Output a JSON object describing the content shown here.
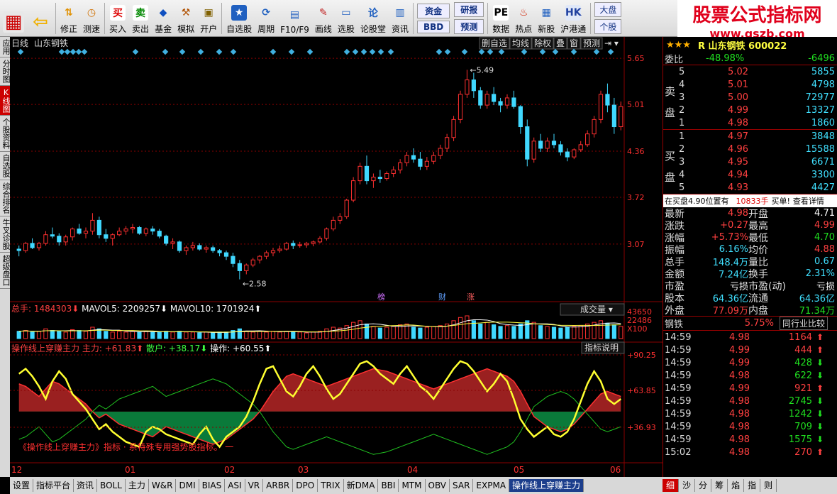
{
  "toolbar": {
    "buttons": [
      {
        "label": "",
        "icon": "app-icon"
      },
      {
        "label": "",
        "icon": "back-arrow-icon"
      },
      {
        "label": "修正",
        "icon": "updown-icon"
      },
      {
        "label": "测速",
        "icon": "clock-icon"
      },
      {
        "label": "买入",
        "icon": "buy-icon",
        "glyph": "买"
      },
      {
        "label": "卖出",
        "icon": "sell-icon",
        "glyph": "卖"
      },
      {
        "label": "基金",
        "icon": "fund-icon"
      },
      {
        "label": "模拟",
        "icon": "hammer-icon"
      },
      {
        "label": "开户",
        "icon": "lock-icon"
      },
      {
        "label": "自选股",
        "icon": "star-icon"
      },
      {
        "label": "周期",
        "icon": "cycle-icon"
      },
      {
        "label": "F10/F9",
        "icon": "f10-icon"
      },
      {
        "label": "画线",
        "icon": "pen-icon"
      },
      {
        "label": "选股",
        "icon": "monitor-icon"
      },
      {
        "label": "论股堂",
        "icon": "forum-icon",
        "glyph": "论"
      },
      {
        "label": "资讯",
        "icon": "doc-icon"
      },
      {
        "label": "资金",
        "icon": "fund-flow-icon"
      },
      {
        "label": "BBD",
        "icon": ""
      },
      {
        "label": "研报",
        "icon": ""
      },
      {
        "label": "预测",
        "icon": ""
      },
      {
        "label": "数据",
        "icon": "pe-icon",
        "glyph": "PE"
      },
      {
        "label": "热点",
        "icon": "fire-icon"
      },
      {
        "label": "新股",
        "icon": "newstock-icon"
      },
      {
        "label": "沪港通",
        "icon": "hk-icon"
      },
      {
        "label": "大盘",
        "icon": ""
      },
      {
        "label": "个股",
        "icon": ""
      }
    ],
    "brand_title": "股票公式指标网",
    "brand_url": "www.gszb.com"
  },
  "left_tabs": [
    "应用",
    "分时图",
    "K线图",
    "个股资料",
    "自选股",
    "综合排名",
    "牛叉诊股",
    "超级盘口"
  ],
  "chart": {
    "period": "日线",
    "stock_name": "山东钢铁",
    "top_menu": [
      "删自选",
      "均线",
      "除权",
      "叠",
      "窗",
      "预测"
    ],
    "price_levels": [
      "5.65",
      "5.01",
      "4.36",
      "3.72",
      "3.07"
    ],
    "high_label": "5.49",
    "low_label": "2.58",
    "event_labels": [
      {
        "text": "榜",
        "color": "#d070ff"
      },
      {
        "text": "财",
        "color": "#60a0ff"
      },
      {
        "text": "涨",
        "color": "#ff6060"
      }
    ],
    "volume": {
      "total_label": "总手:",
      "total_value": "1484303",
      "mavol5_label": "MAVOL5:",
      "mavol5_value": "2209257",
      "mavol10_label": "MAVOL10:",
      "mavol10_value": "1701924",
      "dropdown": "成交量",
      "levels": [
        "43650",
        "22486",
        "X100"
      ]
    },
    "indicator": {
      "name": "操作线上穿赚主力",
      "main_label": "主力:",
      "main_value": "+61.83",
      "retail_label": "散户:",
      "retail_value": "+38.17",
      "op_label": "操作:",
      "op_value": "+60.55",
      "explain_button": "指标说明",
      "levels": [
        "+90.25",
        "+63.85",
        "+36.93"
      ],
      "footer_text": "《操作线上穿赚主力》指标 · 系特殊专用强势股指标。 一"
    },
    "x_axis": [
      "12",
      "01",
      "02",
      "03",
      "04",
      "05",
      "06"
    ]
  },
  "chart_data": {
    "type": "candlestick",
    "title": "山东钢铁 日线",
    "ylim": [
      2.3,
      5.75
    ],
    "candles": [
      [
        3.0,
        3.05,
        2.9,
        2.98
      ],
      [
        2.98,
        3.1,
        2.95,
        3.08
      ],
      [
        3.08,
        3.15,
        3.0,
        3.02
      ],
      [
        3.02,
        3.1,
        2.98,
        3.08
      ],
      [
        3.08,
        3.25,
        3.05,
        3.2
      ],
      [
        3.2,
        3.3,
        3.15,
        3.18
      ],
      [
        3.18,
        3.22,
        3.05,
        3.1
      ],
      [
        3.1,
        3.2,
        3.05,
        3.17
      ],
      [
        3.17,
        3.3,
        3.12,
        3.28
      ],
      [
        3.28,
        3.35,
        3.2,
        3.22
      ],
      [
        3.22,
        3.3,
        3.15,
        3.25
      ],
      [
        3.25,
        3.5,
        3.2,
        3.4
      ],
      [
        3.4,
        3.45,
        3.15,
        3.2
      ],
      [
        3.2,
        3.28,
        3.1,
        3.15
      ],
      [
        3.15,
        3.22,
        3.05,
        3.2
      ],
      [
        3.2,
        3.3,
        3.18,
        3.25
      ],
      [
        3.25,
        3.32,
        3.2,
        3.28
      ],
      [
        3.28,
        3.35,
        3.22,
        3.3
      ],
      [
        3.3,
        3.32,
        3.2,
        3.22
      ],
      [
        3.22,
        3.3,
        3.18,
        3.28
      ],
      [
        3.28,
        3.32,
        3.2,
        3.25
      ],
      [
        3.25,
        3.28,
        3.15,
        3.18
      ],
      [
        3.18,
        3.2,
        3.05,
        3.08
      ],
      [
        3.08,
        3.15,
        3.0,
        3.1
      ],
      [
        3.1,
        3.12,
        2.95,
        2.98
      ],
      [
        2.98,
        3.05,
        2.92,
        3.02
      ],
      [
        3.02,
        3.1,
        2.98,
        3.05
      ],
      [
        3.05,
        3.08,
        2.98,
        3.0
      ],
      [
        3.0,
        3.05,
        2.95,
        3.02
      ],
      [
        3.02,
        3.05,
        2.95,
        2.98
      ],
      [
        2.98,
        3.0,
        2.9,
        2.95
      ],
      [
        2.95,
        2.98,
        2.85,
        2.9
      ],
      [
        2.9,
        2.95,
        2.75,
        2.8
      ],
      [
        2.8,
        2.85,
        2.58,
        2.7
      ],
      [
        2.7,
        2.8,
        2.65,
        2.78
      ],
      [
        2.78,
        2.88,
        2.75,
        2.85
      ],
      [
        2.85,
        2.92,
        2.8,
        2.9
      ],
      [
        2.9,
        2.98,
        2.86,
        2.95
      ],
      [
        2.95,
        3.02,
        2.9,
        2.98
      ],
      [
        2.98,
        3.05,
        2.95,
        3.0
      ],
      [
        3.0,
        3.1,
        2.98,
        3.08
      ],
      [
        3.08,
        3.12,
        3.0,
        3.05
      ],
      [
        3.05,
        3.1,
        3.02,
        3.06
      ],
      [
        3.06,
        3.1,
        3.02,
        3.08
      ],
      [
        3.08,
        3.12,
        3.04,
        3.1
      ],
      [
        3.1,
        3.18,
        3.08,
        3.15
      ],
      [
        3.15,
        3.3,
        3.12,
        3.28
      ],
      [
        3.28,
        3.45,
        3.25,
        3.4
      ],
      [
        3.4,
        3.5,
        3.35,
        3.45
      ],
      [
        3.45,
        3.7,
        3.42,
        3.68
      ],
      [
        3.68,
        4.0,
        3.65,
        3.95
      ],
      [
        3.95,
        4.2,
        3.9,
        4.15
      ],
      [
        4.15,
        4.3,
        3.9,
        3.95
      ],
      [
        3.95,
        4.05,
        3.85,
        4.0
      ],
      [
        4.0,
        4.1,
        3.92,
        3.98
      ],
      [
        3.98,
        4.08,
        3.95,
        4.05
      ],
      [
        4.05,
        4.15,
        4.0,
        4.1
      ],
      [
        4.1,
        4.25,
        4.05,
        4.2
      ],
      [
        4.2,
        4.35,
        4.15,
        4.3
      ],
      [
        4.3,
        4.4,
        4.2,
        4.25
      ],
      [
        4.25,
        4.35,
        4.1,
        4.15
      ],
      [
        4.15,
        4.28,
        4.1,
        4.22
      ],
      [
        4.22,
        4.35,
        4.18,
        4.3
      ],
      [
        4.3,
        4.45,
        4.25,
        4.4
      ],
      [
        4.4,
        4.6,
        4.35,
        4.55
      ],
      [
        4.55,
        4.85,
        4.5,
        4.8
      ],
      [
        4.8,
        5.2,
        4.75,
        5.15
      ],
      [
        5.15,
        5.49,
        5.1,
        5.35
      ],
      [
        5.35,
        5.45,
        5.1,
        5.2
      ],
      [
        5.2,
        5.25,
        4.95,
        5.0
      ],
      [
        5.0,
        5.2,
        4.95,
        5.15
      ],
      [
        5.15,
        5.25,
        5.0,
        5.05
      ],
      [
        5.05,
        5.1,
        4.9,
        5.0
      ],
      [
        5.0,
        5.15,
        4.95,
        5.1
      ],
      [
        5.1,
        5.2,
        4.95,
        4.98
      ],
      [
        4.98,
        5.0,
        4.6,
        4.7
      ],
      [
        4.7,
        4.8,
        4.15,
        4.25
      ],
      [
        4.25,
        4.55,
        4.2,
        4.5
      ],
      [
        4.5,
        4.6,
        4.35,
        4.4
      ],
      [
        4.4,
        4.55,
        4.35,
        4.5
      ],
      [
        4.5,
        4.6,
        4.4,
        4.45
      ],
      [
        4.45,
        4.5,
        4.3,
        4.35
      ],
      [
        4.35,
        4.4,
        4.22,
        4.28
      ],
      [
        4.28,
        4.4,
        4.25,
        4.38
      ],
      [
        4.38,
        4.5,
        4.35,
        4.45
      ],
      [
        4.45,
        4.65,
        4.42,
        4.6
      ],
      [
        4.6,
        4.85,
        4.55,
        4.8
      ],
      [
        4.8,
        5.2,
        4.75,
        5.15
      ],
      [
        5.15,
        5.3,
        4.9,
        5.0
      ],
      [
        5.0,
        5.1,
        4.6,
        4.7
      ],
      [
        4.7,
        5.05,
        4.65,
        4.98
      ]
    ],
    "volume": [
      9,
      10,
      8,
      9,
      12,
      10,
      9,
      8,
      11,
      10,
      9,
      14,
      12,
      9,
      8,
      9,
      8,
      9,
      8,
      9,
      8,
      8,
      9,
      8,
      9,
      8,
      8,
      7,
      8,
      7,
      8,
      8,
      10,
      12,
      9,
      8,
      9,
      8,
      9,
      8,
      9,
      8,
      8,
      7,
      8,
      9,
      12,
      14,
      13,
      16,
      20,
      22,
      18,
      15,
      13,
      14,
      15,
      17,
      18,
      14,
      13,
      14,
      15,
      16,
      18,
      22,
      26,
      28,
      22,
      18,
      20,
      17,
      15,
      16,
      15,
      18,
      22,
      20,
      16,
      15,
      14,
      13,
      14,
      15,
      16,
      18,
      20,
      22,
      19,
      17,
      15
    ],
    "indicator_main": [
      72,
      70,
      66,
      62,
      68,
      74,
      72,
      68,
      64,
      60,
      56,
      50,
      45,
      48,
      44,
      40,
      38,
      36,
      34,
      32,
      30,
      34,
      38,
      36,
      34,
      32,
      30,
      28,
      26,
      24,
      26,
      28,
      32,
      36,
      40,
      44,
      50,
      58,
      66,
      72,
      78,
      80,
      78,
      76,
      74,
      72,
      70,
      72,
      74,
      76,
      78,
      80,
      82,
      84,
      83,
      82,
      80,
      78,
      76,
      74,
      72,
      70,
      68,
      70,
      72,
      74,
      76,
      78,
      80,
      82,
      84,
      82,
      80,
      78,
      74,
      66,
      56,
      46,
      42,
      38,
      36,
      34,
      36,
      40,
      46,
      52,
      58,
      64,
      66,
      64,
      62
    ],
    "indicator_op": [
      80,
      84,
      78,
      70,
      60,
      74,
      82,
      76,
      64,
      58,
      52,
      44,
      36,
      40,
      34,
      30,
      26,
      24,
      22,
      34,
      38,
      36,
      32,
      30,
      28,
      26,
      24,
      32,
      38,
      28,
      22,
      30,
      34,
      38,
      46,
      58,
      72,
      84,
      86,
      76,
      66,
      62,
      70,
      80,
      86,
      78,
      68,
      60,
      64,
      72,
      80,
      88,
      90,
      86,
      80,
      76,
      72,
      80,
      86,
      78,
      70,
      66,
      60,
      68,
      76,
      84,
      90,
      88,
      82,
      74,
      66,
      72,
      80,
      74,
      60,
      44,
      36,
      30,
      34,
      38,
      32,
      30,
      34,
      44,
      58,
      72,
      82,
      74,
      60,
      56,
      60
    ]
  },
  "right_panel": {
    "stars": "★★★",
    "stock_code_label": "R 山东钢铁 600022",
    "weibi_label": "委比",
    "weibi_value": "-48.98%",
    "weibi_diff": "-6496",
    "sell_label_1": "卖",
    "sell_label_2": "盘",
    "buy_label_1": "买",
    "buy_label_2": "盘",
    "sells": [
      {
        "level": "5",
        "price": "5.02",
        "vol": "5855"
      },
      {
        "level": "4",
        "price": "5.01",
        "vol": "4798"
      },
      {
        "level": "3",
        "price": "5.00",
        "vol": "72977"
      },
      {
        "level": "2",
        "price": "4.99",
        "vol": "13327"
      },
      {
        "level": "1",
        "price": "4.98",
        "vol": "1860"
      }
    ],
    "buys": [
      {
        "level": "1",
        "price": "4.97",
        "vol": "3848"
      },
      {
        "level": "2",
        "price": "4.96",
        "vol": "15588"
      },
      {
        "level": "3",
        "price": "4.95",
        "vol": "6671"
      },
      {
        "level": "4",
        "price": "4.94",
        "vol": "3300"
      },
      {
        "level": "5",
        "price": "4.93",
        "vol": "4427"
      }
    ],
    "notice_text": "在买盘4.90位置有",
    "notice_vol": "10833手",
    "notice_action": "买单!",
    "notice_link": "查看详情",
    "quote_rows": [
      {
        "k1": "最新",
        "v1": "4.98",
        "c1": "red",
        "k2": "开盘",
        "v2": "4.71",
        "c2": "white"
      },
      {
        "k1": "涨跌",
        "v1": "+0.27",
        "c1": "red",
        "k2": "最高",
        "v2": "4.99",
        "c2": "red"
      },
      {
        "k1": "涨幅",
        "v1": "+5.73%",
        "c1": "red",
        "k2": "最低",
        "v2": "4.70",
        "c2": "green"
      },
      {
        "k1": "振幅",
        "v1": "6.16%",
        "c1": "cyan",
        "k2": "均价",
        "v2": "4.88",
        "c2": "red"
      },
      {
        "k1": "总手",
        "v1": "148.4万",
        "c1": "cyan",
        "k2": "量比",
        "v2": "0.67",
        "c2": "cyan"
      },
      {
        "k1": "金额",
        "v1": "7.24亿",
        "c1": "cyan",
        "k2": "换手",
        "v2": "2.31%",
        "c2": "cyan"
      },
      {
        "k1": "市盈",
        "v1": "亏损",
        "c1": "white",
        "k2": "市盈(动)",
        "v2": "亏损",
        "c2": "white"
      },
      {
        "k1": "股本",
        "v1": "64.36亿",
        "c1": "cyan",
        "k2": "流通",
        "v2": "64.36亿",
        "c2": "cyan"
      },
      {
        "k1": "外盘",
        "v1": "77.09万",
        "c1": "red",
        "k2": "内盘",
        "v2": "71.34万",
        "c2": "green"
      }
    ],
    "sector_label": "钢铁",
    "sector_pct": "5.75%",
    "sector_button": "同行业比较",
    "ticks": [
      {
        "time": "14:59",
        "price": "4.98",
        "vol": "1164",
        "dir": "up"
      },
      {
        "time": "14:59",
        "price": "4.99",
        "vol": "444",
        "dir": "up"
      },
      {
        "time": "14:59",
        "price": "4.99",
        "vol": "428",
        "dir": "down"
      },
      {
        "time": "14:59",
        "price": "4.98",
        "vol": "622",
        "dir": "down"
      },
      {
        "time": "14:59",
        "price": "4.99",
        "vol": "921",
        "dir": "up"
      },
      {
        "time": "14:59",
        "price": "4.98",
        "vol": "2745",
        "dir": "down"
      },
      {
        "time": "14:59",
        "price": "4.98",
        "vol": "1242",
        "dir": "down"
      },
      {
        "time": "14:59",
        "price": "4.98",
        "vol": "709",
        "dir": "down"
      },
      {
        "time": "14:59",
        "price": "4.98",
        "vol": "1575",
        "dir": "down"
      },
      {
        "time": "15:02",
        "price": "4.98",
        "vol": "270",
        "dir": "up"
      }
    ]
  },
  "bottom_tabs": [
    "设置",
    "指标平台",
    "资讯",
    "BOLL",
    "主力",
    "W&R",
    "DMI",
    "BIAS",
    "ASI",
    "VR",
    "ARBR",
    "DPO",
    "TRIX",
    "新DMA",
    "BBI",
    "MTM",
    "OBV",
    "SAR",
    "EXPMA",
    "操作线上穿赚主力"
  ],
  "active_bottom_tab": 19,
  "right_bottom_tabs": [
    "细",
    "沙",
    "分",
    "筹",
    "焰",
    "指",
    "则"
  ],
  "colors": {
    "up": "#ff3030",
    "down": "#40d8ff",
    "grid": "#8a0000",
    "main_fill": "#9a2020",
    "retail_fill": "#0a7a3a",
    "op_line": "#ffff30"
  }
}
